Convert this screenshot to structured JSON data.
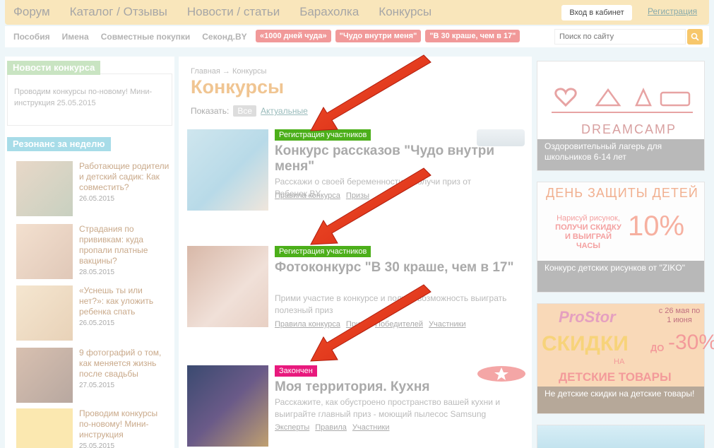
{
  "topnav": [
    "Форум",
    "Каталог / Отзывы",
    "Новости / статьи",
    "Барахолка",
    "Конкурсы"
  ],
  "login_label": "Вход в кабинет",
  "register_label": "Регистрация",
  "subnav": [
    "Пособия",
    "Имена",
    "Совместные покупки",
    "Секонд.BY"
  ],
  "pills": [
    "«1000 дней чуда»",
    "\"Чудо внутри меня\"",
    "\"В 30 краше, чем в 17\""
  ],
  "search_placeholder": "Поиск по сайту",
  "left": {
    "news_title": "Новости конкурса",
    "news_text": "Проводим конкурсы по-новому! Мини-инструкция",
    "news_date": "25.05.2015",
    "resonance_title": "Резонанс за неделю",
    "items": [
      {
        "title": "Работающие родители и детский садик: Как совместить?",
        "date": "26.05.2015"
      },
      {
        "title": "Страдания по прививкам: куда пропали платные вакцины?",
        "date": "28.05.2015"
      },
      {
        "title": "«Уснешь ты или нет?»: как уложить ребенка спать",
        "date": "26.05.2015"
      },
      {
        "title": "9 фотографий о том, как меняется жизнь после свадьбы",
        "date": "27.05.2015"
      },
      {
        "title": "Проводим конкурсы по-новому! Мини-инструкция",
        "date": "25.05.2015"
      }
    ]
  },
  "main": {
    "crumb": "Главная → Конкурсы",
    "title": "Конкурсы",
    "show_label": "Показать:",
    "show_all": "Все",
    "show_active": "Актуальные"
  },
  "contests": [
    {
      "badge": "Регистрация участников",
      "title": "Конкурс рассказов \"Чудо внутри меня\"",
      "desc": "Расскажи о своей беременности и получи приз от Ребенок.BY",
      "links": [
        "Правила конкурса",
        "Призы"
      ]
    },
    {
      "badge": "Регистрация участников",
      "title": "Фотоконкурс \"В 30 краше, чем в 17\"",
      "desc": "Прими участие в конкурсе и получи возможность выиграть полезный приз",
      "links": [
        "Правила конкурса",
        "Призы",
        "Победителей",
        "Участники"
      ]
    },
    {
      "badge": "Закончен",
      "title": "Моя территория. Кухня",
      "desc": "Расскажите, как обустроено пространство вашей кухни и выиграйте главный приз - моющий пылесос Samsung",
      "links": [
        "Эксперты",
        "Правила",
        "Участники"
      ]
    }
  ],
  "ads": [
    {
      "caption": "Оздоровительный лагерь для школьников 6-14 лет",
      "logo": "DREAMCAMP"
    },
    {
      "caption": "Конкурс детских рисунков от \"ZIKO\"",
      "headline": "ДЕНЬ ЗАЩИТЫ ДЕТЕЙ",
      "line1": "Нарисуй рисунок,",
      "line2": "ПОЛУЧИ СКИДКУ",
      "line3": "И ВЫИГРАЙ ЧАСЫ",
      "percent": "10%"
    },
    {
      "caption": "Не детские скидки на детские товары!",
      "brand": "ProStor",
      "dates": "с 26 мая по 1 июня",
      "big": "СКИДКИ",
      "upto": "ДО",
      "pct": "-30%",
      "sub": "НА",
      "sub2": "ДЕТСКИЕ ТОВАРЫ"
    }
  ],
  "colors": {
    "green_badge": "#4caf1a",
    "pink_badge": "#e8197d",
    "arrow": "#e8311a"
  }
}
